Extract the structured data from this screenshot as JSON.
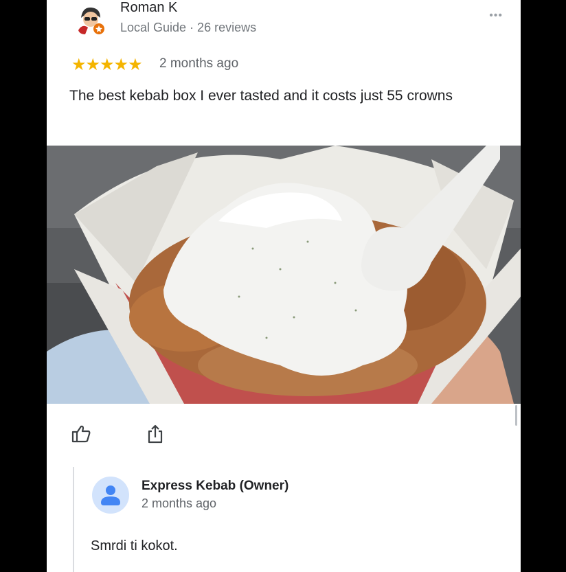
{
  "review": {
    "reviewer_name": "Roman K",
    "reviewer_meta": "Local Guide · 26 reviews",
    "more_menu": "•••",
    "stars": "★★★★★",
    "rating": 5,
    "time": "2 months ago",
    "text": "The best kebab box I ever tasted and it costs just 55 crowns"
  },
  "actions": {
    "like_icon": "thumbs-up-icon",
    "share_icon": "share-icon"
  },
  "owner_reply": {
    "name": "Express Kebab (Owner)",
    "time": "2 months ago",
    "text": "Smrdi ti kokot."
  },
  "colors": {
    "star": "#f4b400",
    "owner_avatar": "#4285f4",
    "owner_avatar_bg": "#d2e3fc"
  }
}
